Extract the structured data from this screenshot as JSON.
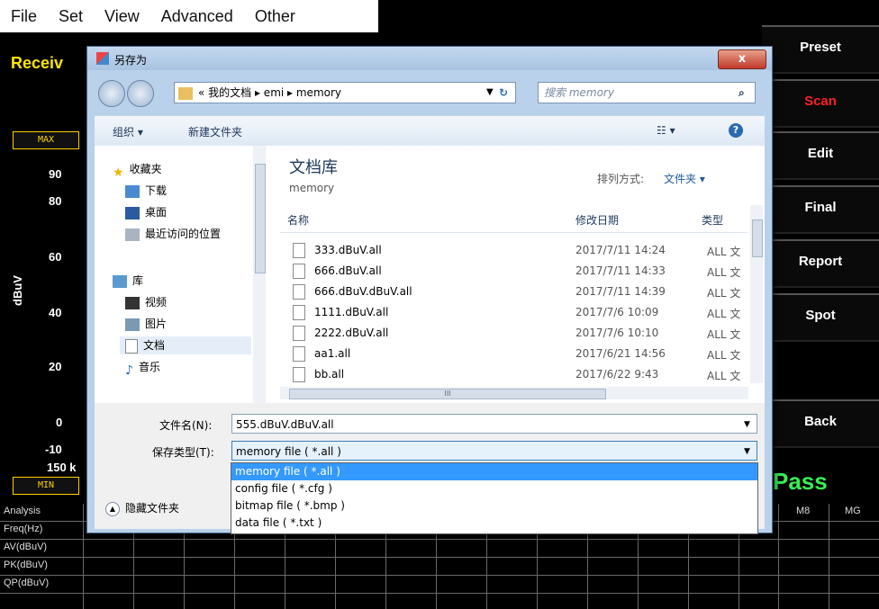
{
  "menu": [
    "File",
    "Set",
    "View",
    "Advanced",
    "Other"
  ],
  "app": {
    "title": "Receiv",
    "max_tag": "MAX",
    "min_tag": "MIN",
    "y_unit": "dBuV",
    "y_ticks": [
      "90",
      "80",
      "60",
      "40",
      "20",
      "0",
      "-10"
    ],
    "x_start": "150 k",
    "pass_label": "Pass"
  },
  "sidebar": {
    "buttons": [
      "Preset",
      "Scan",
      "Edit",
      "Final",
      "Report",
      "Spot",
      "Back"
    ]
  },
  "table": {
    "row_labels": [
      "Analysis",
      "Freq(Hz)",
      "AV(dBuV)",
      "PK(dBuV)",
      "QP(dBuV)"
    ],
    "headers_right": [
      "M8",
      "MG"
    ]
  },
  "dialog": {
    "title": "另存为",
    "close_symbol": "x",
    "address": "« 我的文档 ▸ emi ▸ memory",
    "search_placeholder": "搜索 memory",
    "toolbar": {
      "organize": "组织 ▾",
      "new_folder": "新建文件夹"
    },
    "nav": {
      "favorites": "收藏夹",
      "downloads": "下载",
      "desktop": "桌面",
      "recent": "最近访问的位置",
      "libraries": "库",
      "videos": "视频",
      "pictures": "图片",
      "documents": "文档",
      "music": "音乐"
    },
    "library_title": "文档库",
    "library_sub": "memory",
    "sort_label": "排列方式:",
    "sort_value": "文件夹 ▾",
    "columns": {
      "name": "名称",
      "date": "修改日期",
      "type": "类型"
    },
    "files": [
      {
        "name": "333.dBuV.all",
        "date": "2017/7/11 14:24",
        "type": "ALL 文"
      },
      {
        "name": "666.dBuV.all",
        "date": "2017/7/11 14:33",
        "type": "ALL 文"
      },
      {
        "name": "666.dBuV.dBuV.all",
        "date": "2017/7/11 14:39",
        "type": "ALL 文"
      },
      {
        "name": "1111.dBuV.all",
        "date": "2017/7/6 10:09",
        "type": "ALL 文"
      },
      {
        "name": "2222.dBuV.all",
        "date": "2017/7/6 10:10",
        "type": "ALL 文"
      },
      {
        "name": "aa1.all",
        "date": "2017/6/21 14:56",
        "type": "ALL 文"
      },
      {
        "name": "bb.all",
        "date": "2017/6/22 9:43",
        "type": "ALL 文"
      }
    ],
    "filename_label": "文件名(N):",
    "filename_value": "555.dBuV.dBuV.all",
    "filetype_label": "保存类型(T):",
    "filetype_value": "memory file ( *.all )",
    "hide_folders": "隐藏文件夹",
    "filetype_options": [
      "memory file ( *.all )",
      "config file ( *.cfg )",
      "bitmap file ( *.bmp )",
      "data file ( *.txt )"
    ],
    "hscroll_mark": "III"
  }
}
